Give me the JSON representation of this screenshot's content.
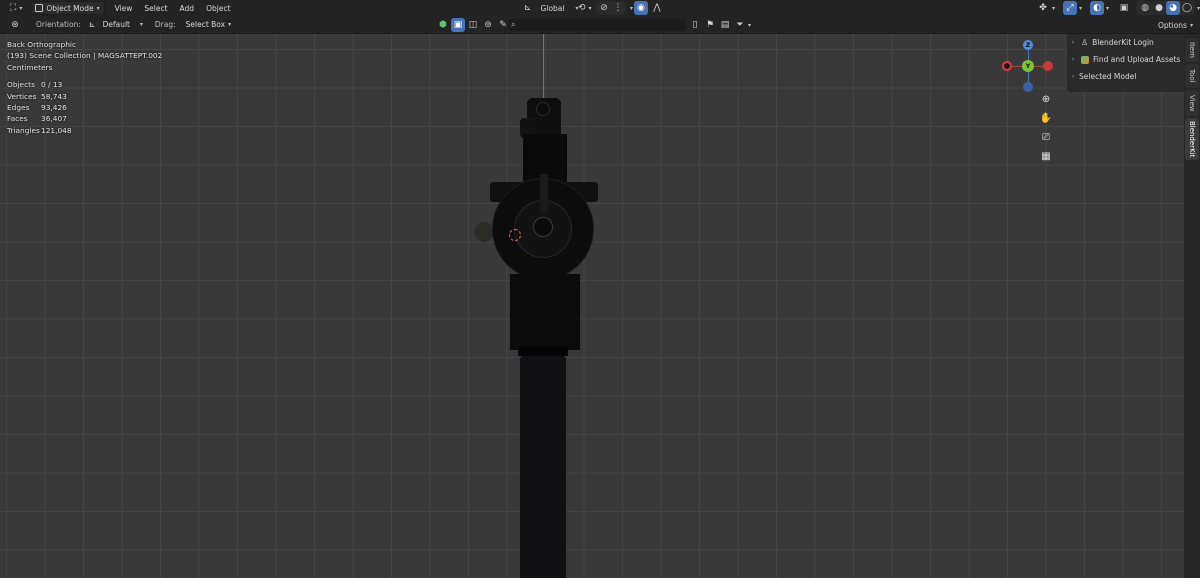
{
  "header": {
    "mode": "Object Mode",
    "menus": [
      "View",
      "Select",
      "Add",
      "Object"
    ],
    "transform_orientation": "Global",
    "options": "Options"
  },
  "toolbar": {
    "orientation_label": "Orientation:",
    "orientation_value": "Default",
    "drag_label": "Drag:",
    "drag_value": "Select Box",
    "search_placeholder": ""
  },
  "viewport": {
    "view_name": "Back Orthographic",
    "collection": "(193) Scene Collection | MAGSATTEPT.002",
    "units": "Centimeters",
    "stats": [
      {
        "label": "Objects",
        "value": "0 / 13"
      },
      {
        "label": "Vertices",
        "value": "58,743"
      },
      {
        "label": "Edges",
        "value": "93,426"
      },
      {
        "label": "Faces",
        "value": "36,407"
      },
      {
        "label": "Triangles",
        "value": "121,048"
      }
    ]
  },
  "gizmo": {
    "z": "Z",
    "y": "Y",
    "colors": {
      "x": "#e3393a",
      "y": "#7cc23a",
      "z": "#4a8fe0",
      "neg_z": "#3a62a0",
      "neg_x": "#8a3434"
    }
  },
  "sidebar": {
    "items": [
      {
        "label": "BlenderKit Login",
        "icon": "user-icon"
      },
      {
        "label": "Find and Upload Assets",
        "icon": "blenderkit-logo-icon"
      },
      {
        "label": "Selected Model",
        "icon": ""
      }
    ],
    "tabs": [
      "Item",
      "Tool",
      "View",
      "BlenderKit"
    ]
  }
}
